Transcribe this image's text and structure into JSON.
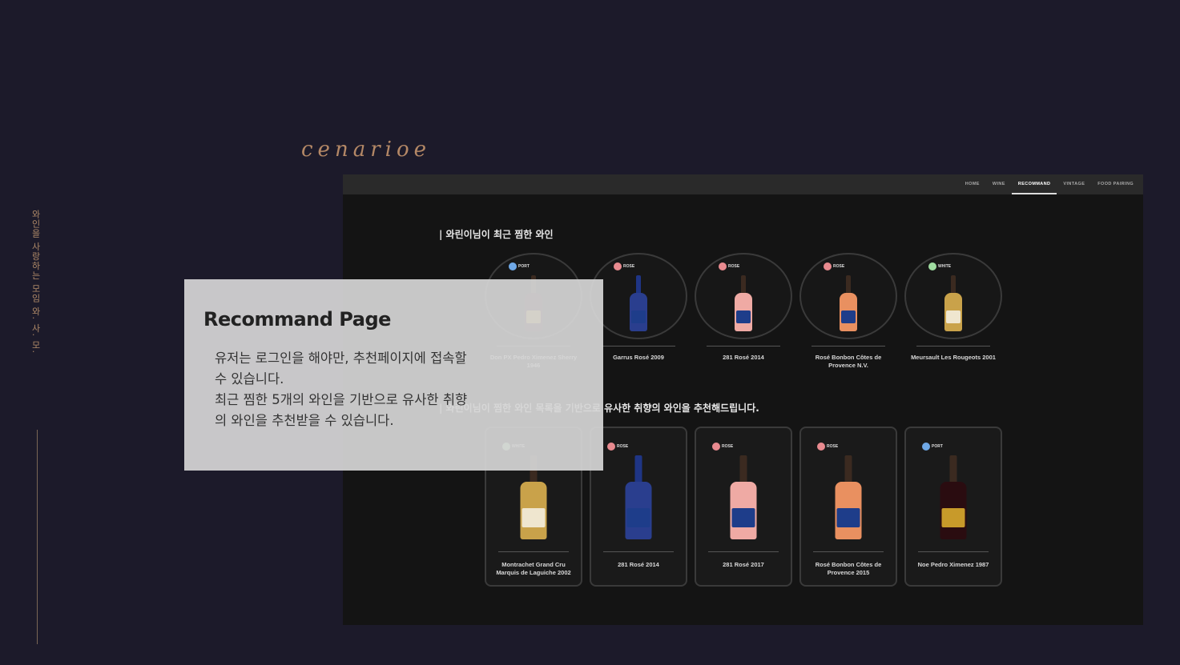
{
  "side": {
    "vertical_text": "와인을 사랑하는 모임 와. 사. 모."
  },
  "logo": "cenarioe",
  "nav": {
    "items": [
      "HOME",
      "WINE",
      "RECOMMAND",
      "VINTAGE",
      "FOOD PAIRING"
    ],
    "active": "RECOMMAND"
  },
  "section1": {
    "title": "| 와린이님이 최근 찜한 와인"
  },
  "section2": {
    "title": "| 와린이님이 찜한 와인 목록을 기반으로 유사한 취향의 와인을 추천해드립니다."
  },
  "recent": [
    {
      "type": "PORT",
      "name": "Don PX Pedro Ximenez Sherry 1946"
    },
    {
      "type": "ROSE",
      "name": "Garrus Rosé 2009"
    },
    {
      "type": "ROSE",
      "name": "281 Rosé 2014"
    },
    {
      "type": "ROSE",
      "name": "Rosé Bonbon Côtes de Provence N.V."
    },
    {
      "type": "WHITE",
      "name": "Meursault Les Rougeots 2001"
    }
  ],
  "recommended": [
    {
      "type": "WHITE",
      "name": "Montrachet Grand Cru Marquis de Laguiche 2002"
    },
    {
      "type": "ROSE",
      "name": "281 Rosé 2014"
    },
    {
      "type": "ROSE",
      "name": "281 Rosé 2017"
    },
    {
      "type": "ROSE",
      "name": "Rosé Bonbon Côtes de Provence 2015"
    },
    {
      "type": "PORT",
      "name": "Noe Pedro Ximenez 1987"
    }
  ],
  "overlay": {
    "title": "Recommand Page",
    "line1": "유저는 로그인을 해야만, 추천페이지에 접속할 수 있습니다.",
    "line2": "최근 찜한 5개의 와인을 기반으로 유사한 취향의 와인을 추천받을 수 있습니다."
  },
  "colors": {
    "PORT": "#6fa8e6",
    "ROSE": "#e88a8f",
    "WHITE": "#9fdca0",
    "accent": "#b48866"
  }
}
